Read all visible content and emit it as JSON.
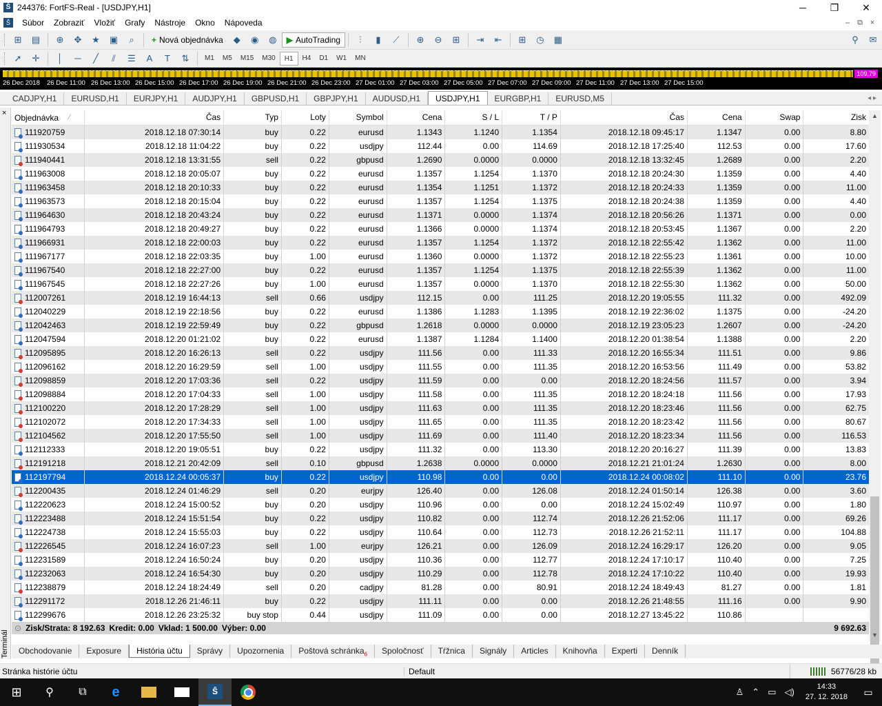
{
  "window": {
    "title": "244376: FortFS-Real - [USDJPY,H1]",
    "minimize": "─",
    "restore": "❐",
    "close": "✕"
  },
  "menu": {
    "items": [
      "Súbor",
      "Zobraziť",
      "Vložiť",
      "Grafy",
      "Nástroje",
      "Okno",
      "Nápoveda"
    ]
  },
  "toolbar": {
    "new_order_label": "Nová objednávka",
    "autotrading_label": "AutoTrading",
    "timeframes": [
      "M1",
      "M5",
      "M15",
      "M30",
      "H1",
      "H4",
      "D1",
      "W1",
      "MN"
    ],
    "active_timeframe": "H1"
  },
  "chart": {
    "price_tag": "109.79",
    "time_labels": [
      "26 Dec 2018",
      "26 Dec 11:00",
      "26 Dec 13:00",
      "26 Dec 15:00",
      "26 Dec 17:00",
      "26 Dec 19:00",
      "26 Dec 21:00",
      "26 Dec 23:00",
      "27 Dec 01:00",
      "27 Dec 03:00",
      "27 Dec 05:00",
      "27 Dec 07:00",
      "27 Dec 09:00",
      "27 Dec 11:00",
      "27 Dec 13:00",
      "27 Dec 15:00"
    ]
  },
  "chart_tabs": [
    "CADJPY,H1",
    "EURUSD,H1",
    "EURJPY,H1",
    "AUDJPY,H1",
    "GBPUSD,H1",
    "GBPJPY,H1",
    "AUDUSD,H1",
    "USDJPY,H1",
    "EURGBP,H1",
    "EURUSD,M5"
  ],
  "active_chart_tab": "USDJPY,H1",
  "columns": {
    "order": "Objednávka",
    "time_open": "Čas",
    "type": "Typ",
    "lots": "Loty",
    "symbol": "Symbol",
    "price_open": "Cena",
    "sl": "S / L",
    "tp": "T / P",
    "time_close": "Čas",
    "price_close": "Cena",
    "swap": "Swap",
    "profit": "Zisk"
  },
  "rows": [
    [
      "111920759",
      "2018.12.18 07:30:14",
      "buy",
      "0.22",
      "eurusd",
      "1.1343",
      "1.1240",
      "1.1354",
      "2018.12.18 09:45:17",
      "1.1347",
      "0.00",
      "8.80"
    ],
    [
      "111930534",
      "2018.12.18 11:04:22",
      "buy",
      "0.22",
      "usdjpy",
      "112.44",
      "0.00",
      "114.69",
      "2018.12.18 17:25:40",
      "112.53",
      "0.00",
      "17.60"
    ],
    [
      "111940441",
      "2018.12.18 13:31:55",
      "sell",
      "0.22",
      "gbpusd",
      "1.2690",
      "0.0000",
      "0.0000",
      "2018.12.18 13:32:45",
      "1.2689",
      "0.00",
      "2.20"
    ],
    [
      "111963008",
      "2018.12.18 20:05:07",
      "buy",
      "0.22",
      "eurusd",
      "1.1357",
      "1.1254",
      "1.1370",
      "2018.12.18 20:24:30",
      "1.1359",
      "0.00",
      "4.40"
    ],
    [
      "111963458",
      "2018.12.18 20:10:33",
      "buy",
      "0.22",
      "eurusd",
      "1.1354",
      "1.1251",
      "1.1372",
      "2018.12.18 20:24:33",
      "1.1359",
      "0.00",
      "11.00"
    ],
    [
      "111963573",
      "2018.12.18 20:15:04",
      "buy",
      "0.22",
      "eurusd",
      "1.1357",
      "1.1254",
      "1.1375",
      "2018.12.18 20:24:38",
      "1.1359",
      "0.00",
      "4.40"
    ],
    [
      "111964630",
      "2018.12.18 20:43:24",
      "buy",
      "0.22",
      "eurusd",
      "1.1371",
      "0.0000",
      "1.1374",
      "2018.12.18 20:56:26",
      "1.1371",
      "0.00",
      "0.00"
    ],
    [
      "111964793",
      "2018.12.18 20:49:27",
      "buy",
      "0.22",
      "eurusd",
      "1.1366",
      "0.0000",
      "1.1374",
      "2018.12.18 20:53:45",
      "1.1367",
      "0.00",
      "2.20"
    ],
    [
      "111966931",
      "2018.12.18 22:00:03",
      "buy",
      "0.22",
      "eurusd",
      "1.1357",
      "1.1254",
      "1.1372",
      "2018.12.18 22:55:42",
      "1.1362",
      "0.00",
      "11.00"
    ],
    [
      "111967177",
      "2018.12.18 22:03:35",
      "buy",
      "1.00",
      "eurusd",
      "1.1360",
      "0.0000",
      "1.1372",
      "2018.12.18 22:55:23",
      "1.1361",
      "0.00",
      "10.00"
    ],
    [
      "111967540",
      "2018.12.18 22:27:00",
      "buy",
      "0.22",
      "eurusd",
      "1.1357",
      "1.1254",
      "1.1375",
      "2018.12.18 22:55:39",
      "1.1362",
      "0.00",
      "11.00"
    ],
    [
      "111967545",
      "2018.12.18 22:27:26",
      "buy",
      "1.00",
      "eurusd",
      "1.1357",
      "0.0000",
      "1.1370",
      "2018.12.18 22:55:30",
      "1.1362",
      "0.00",
      "50.00"
    ],
    [
      "112007261",
      "2018.12.19 16:44:13",
      "sell",
      "0.66",
      "usdjpy",
      "112.15",
      "0.00",
      "111.25",
      "2018.12.20 19:05:55",
      "111.32",
      "0.00",
      "492.09"
    ],
    [
      "112040229",
      "2018.12.19 22:18:56",
      "buy",
      "0.22",
      "eurusd",
      "1.1386",
      "1.1283",
      "1.1395",
      "2018.12.19 22:36:02",
      "1.1375",
      "0.00",
      "-24.20"
    ],
    [
      "112042463",
      "2018.12.19 22:59:49",
      "buy",
      "0.22",
      "gbpusd",
      "1.2618",
      "0.0000",
      "0.0000",
      "2018.12.19 23:05:23",
      "1.2607",
      "0.00",
      "-24.20"
    ],
    [
      "112047594",
      "2018.12.20 01:21:02",
      "buy",
      "0.22",
      "eurusd",
      "1.1387",
      "1.1284",
      "1.1400",
      "2018.12.20 01:38:54",
      "1.1388",
      "0.00",
      "2.20"
    ],
    [
      "112095895",
      "2018.12.20 16:26:13",
      "sell",
      "0.22",
      "usdjpy",
      "111.56",
      "0.00",
      "111.33",
      "2018.12.20 16:55:34",
      "111.51",
      "0.00",
      "9.86"
    ],
    [
      "112096162",
      "2018.12.20 16:29:59",
      "sell",
      "1.00",
      "usdjpy",
      "111.55",
      "0.00",
      "111.35",
      "2018.12.20 16:53:56",
      "111.49",
      "0.00",
      "53.82"
    ],
    [
      "112098859",
      "2018.12.20 17:03:36",
      "sell",
      "0.22",
      "usdjpy",
      "111.59",
      "0.00",
      "0.00",
      "2018.12.20 18:24:56",
      "111.57",
      "0.00",
      "3.94"
    ],
    [
      "112098884",
      "2018.12.20 17:04:33",
      "sell",
      "1.00",
      "usdjpy",
      "111.58",
      "0.00",
      "111.35",
      "2018.12.20 18:24:18",
      "111.56",
      "0.00",
      "17.93"
    ],
    [
      "112100220",
      "2018.12.20 17:28:29",
      "sell",
      "1.00",
      "usdjpy",
      "111.63",
      "0.00",
      "111.35",
      "2018.12.20 18:23:46",
      "111.56",
      "0.00",
      "62.75"
    ],
    [
      "112102072",
      "2018.12.20 17:34:33",
      "sell",
      "1.00",
      "usdjpy",
      "111.65",
      "0.00",
      "111.35",
      "2018.12.20 18:23:42",
      "111.56",
      "0.00",
      "80.67"
    ],
    [
      "112104562",
      "2018.12.20 17:55:50",
      "sell",
      "1.00",
      "usdjpy",
      "111.69",
      "0.00",
      "111.40",
      "2018.12.20 18:23:34",
      "111.56",
      "0.00",
      "116.53"
    ],
    [
      "112112333",
      "2018.12.20 19:05:51",
      "buy",
      "0.22",
      "usdjpy",
      "111.32",
      "0.00",
      "113.30",
      "2018.12.20 20:16:27",
      "111.39",
      "0.00",
      "13.83"
    ],
    [
      "112191218",
      "2018.12.21 20:42:09",
      "sell",
      "0.10",
      "gbpusd",
      "1.2638",
      "0.0000",
      "0.0000",
      "2018.12.21 21:01:24",
      "1.2630",
      "0.00",
      "8.00"
    ],
    [
      "112197794",
      "2018.12.24 00:05:37",
      "buy",
      "0.22",
      "usdjpy",
      "110.98",
      "0.00",
      "0.00",
      "2018.12.24 00:08:02",
      "111.10",
      "0.00",
      "23.76"
    ],
    [
      "112200435",
      "2018.12.24 01:46:29",
      "sell",
      "0.20",
      "eurjpy",
      "126.40",
      "0.00",
      "126.08",
      "2018.12.24 01:50:14",
      "126.38",
      "0.00",
      "3.60"
    ],
    [
      "112220623",
      "2018.12.24 15:00:52",
      "buy",
      "0.20",
      "usdjpy",
      "110.96",
      "0.00",
      "0.00",
      "2018.12.24 15:02:49",
      "110.97",
      "0.00",
      "1.80"
    ],
    [
      "112223488",
      "2018.12.24 15:51:54",
      "buy",
      "0.22",
      "usdjpy",
      "110.82",
      "0.00",
      "112.74",
      "2018.12.26 21:52:06",
      "111.17",
      "0.00",
      "69.26"
    ],
    [
      "112224738",
      "2018.12.24 15:55:03",
      "buy",
      "0.22",
      "usdjpy",
      "110.64",
      "0.00",
      "112.73",
      "2018.12.26 21:52:11",
      "111.17",
      "0.00",
      "104.88"
    ],
    [
      "112226545",
      "2018.12.24 16:07:23",
      "sell",
      "1.00",
      "eurjpy",
      "126.21",
      "0.00",
      "126.09",
      "2018.12.24 16:29:17",
      "126.20",
      "0.00",
      "9.05"
    ],
    [
      "112231589",
      "2018.12.24 16:50:24",
      "buy",
      "0.20",
      "usdjpy",
      "110.36",
      "0.00",
      "112.77",
      "2018.12.24 17:10:17",
      "110.40",
      "0.00",
      "7.25"
    ],
    [
      "112232063",
      "2018.12.24 16:54:30",
      "buy",
      "0.20",
      "usdjpy",
      "110.29",
      "0.00",
      "112.78",
      "2018.12.24 17:10:22",
      "110.40",
      "0.00",
      "19.93"
    ],
    [
      "112238879",
      "2018.12.24 18:24:49",
      "sell",
      "0.20",
      "cadjpy",
      "81.28",
      "0.00",
      "80.91",
      "2018.12.24 18:49:43",
      "81.27",
      "0.00",
      "1.81"
    ],
    [
      "112291172",
      "2018.12.26 21:46:11",
      "buy",
      "0.22",
      "usdjpy",
      "111.11",
      "0.00",
      "0.00",
      "2018.12.26 21:48:55",
      "111.16",
      "0.00",
      "9.90"
    ],
    [
      "112299676",
      "2018.12.26 23:25:32",
      "buy stop",
      "0.44",
      "usdjpy",
      "111.09",
      "0.00",
      "0.00",
      "2018.12.27 13:45:22",
      "110.86",
      "",
      ""
    ]
  ],
  "selected_order": "112197794",
  "summary": {
    "profit": "Zisk/Strata: 8 192.63",
    "credit": "Kredit: 0.00",
    "deposit": "Vklad: 1 500.00",
    "withdrawal": "Výber: 0.00",
    "total": "9 692.63"
  },
  "terminal": {
    "label": "Terminál",
    "close": "×"
  },
  "bottom_tabs": [
    "Obchodovanie",
    "Exposure",
    "História účtu",
    "Správy",
    "Upozornenia",
    "Poštová schránka",
    "Spoločnosť",
    "Tŕžnica",
    "Signály",
    "Articles",
    "Knihovňa",
    "Experti",
    "Denník"
  ],
  "active_bottom_tab": "História účtu",
  "mailbox_badge": "6",
  "statusbar": {
    "left": "Stránka histórie účtu",
    "profile": "Default",
    "traffic": "56776/28 kb"
  },
  "taskbar": {
    "time": "14:33",
    "date": "27. 12. 2018"
  },
  "colors": {
    "selection": "#0066cc",
    "row_alt": "#e8e8e8",
    "chart_bg": "#000000",
    "price_tag": "#e000e0"
  }
}
